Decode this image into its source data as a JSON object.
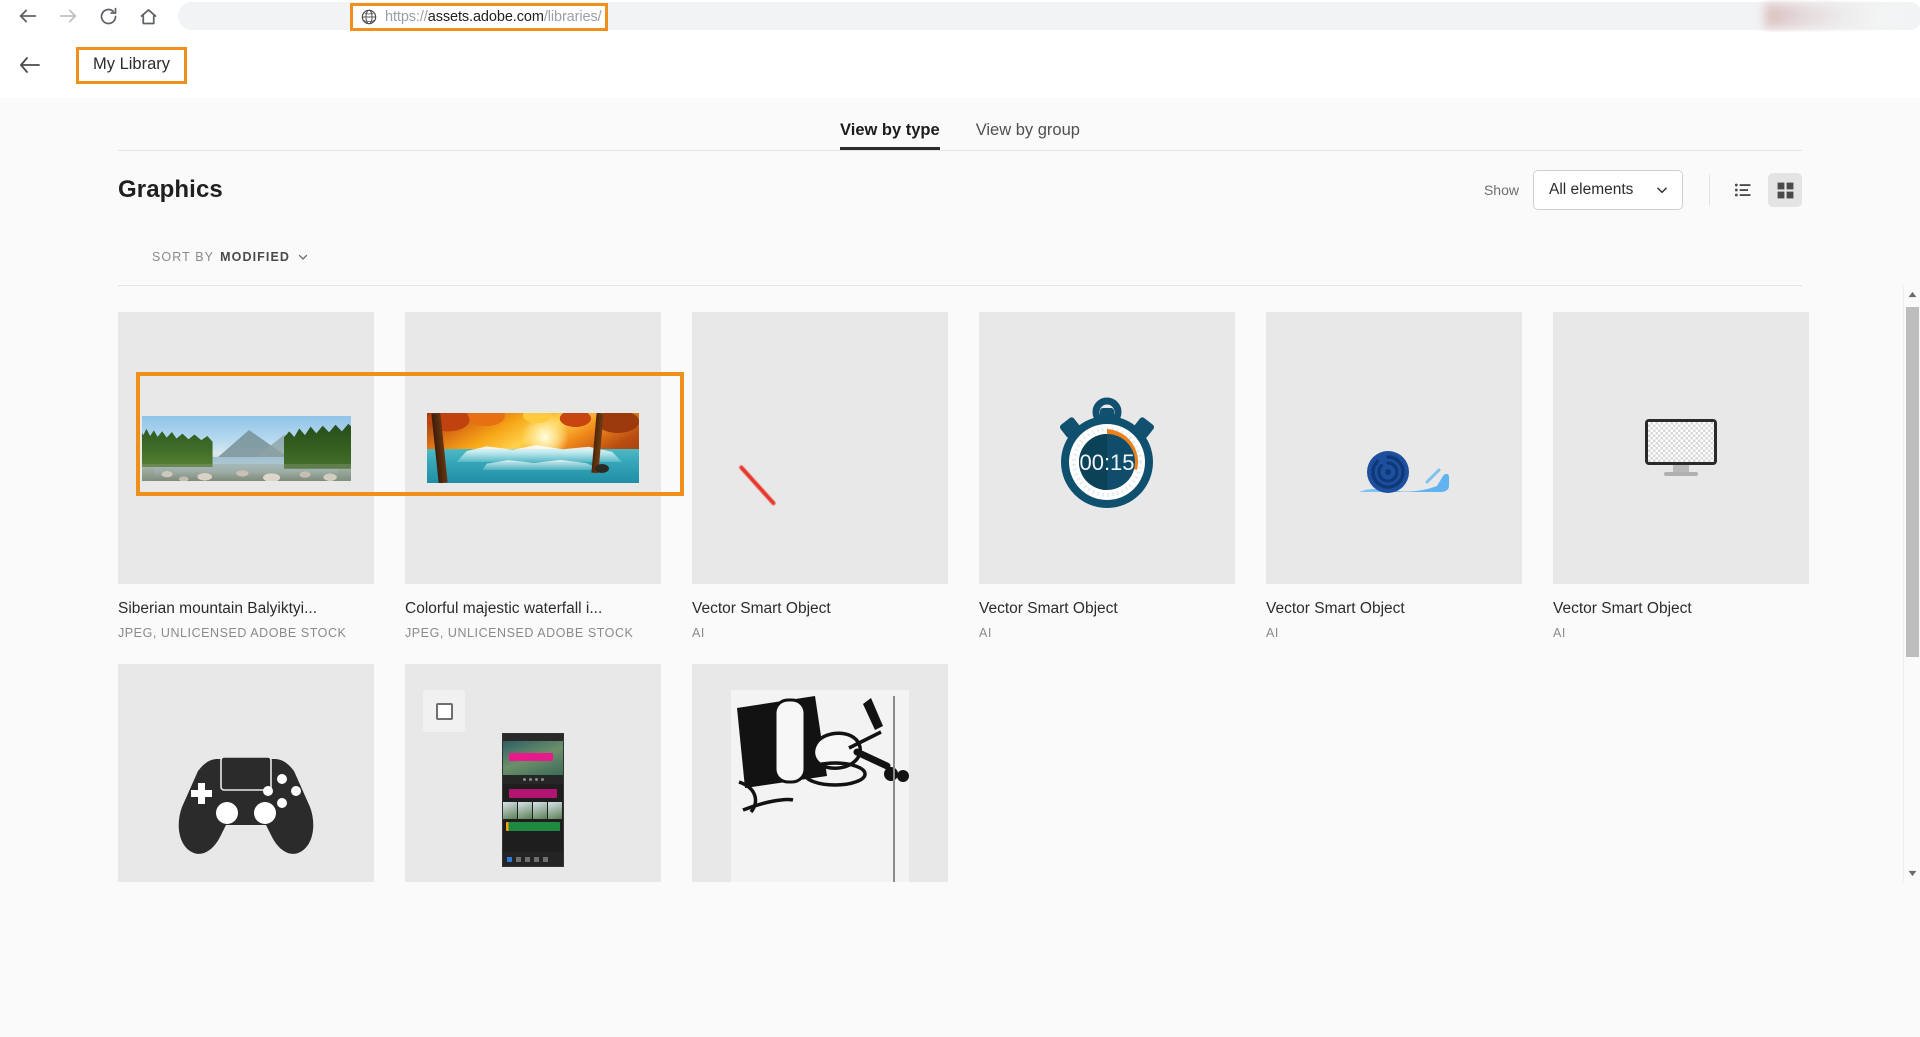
{
  "browser": {
    "back_icon": "arrow-left-icon",
    "forward_icon": "arrow-right-icon",
    "reload_icon": "reload-icon",
    "home_icon": "home-icon",
    "site_icon": "globe-icon",
    "url_prefix": "https://",
    "url_domain": "assets.adobe.com",
    "url_path": "/libraries/",
    "url_full": "https://assets.adobe.com/libraries/",
    "highlight_color": "#ef8f1c"
  },
  "app_header": {
    "back_icon": "arrow-left-icon",
    "breadcrumb": "My Library"
  },
  "tabs": [
    {
      "label": "View by type",
      "active": true
    },
    {
      "label": "View by group",
      "active": false
    }
  ],
  "section": {
    "title": "Graphics",
    "show_label": "Show",
    "filter_value": "All elements",
    "filter_chevron_icon": "chevron-down-icon",
    "list_view_icon": "list-view-icon",
    "grid_view_icon": "grid-view-icon",
    "active_view": "grid"
  },
  "sort": {
    "prefix": "SORT BY",
    "value": "MODIFIED",
    "chevron_icon": "chevron-down-icon"
  },
  "grid": {
    "items": [
      {
        "title": "Siberian mountain Balyiktyi...",
        "meta": "JPEG, UNLICENSED ADOBE STOCK",
        "thumb": "mountain-photo",
        "selected": true
      },
      {
        "title": "Colorful majestic waterfall i...",
        "meta": "JPEG, UNLICENSED ADOBE STOCK",
        "thumb": "waterfall-photo",
        "selected": true
      },
      {
        "title": "Vector Smart Object",
        "meta": "AI",
        "thumb": "red-line",
        "selected": false
      },
      {
        "title": "Vector Smart Object",
        "meta": "AI",
        "thumb": "stopwatch",
        "selected": false
      },
      {
        "title": "Vector Smart Object",
        "meta": "AI",
        "thumb": "snail",
        "selected": false
      },
      {
        "title": "Vector Smart Object",
        "meta": "AI",
        "thumb": "monitor",
        "selected": false
      },
      {
        "title": "",
        "meta": "",
        "thumb": "gamepad",
        "selected": false
      },
      {
        "title": "",
        "meta": "",
        "thumb": "video-editor-ui",
        "selected": false
      },
      {
        "title": "",
        "meta": "",
        "thumb": "bw-lineart",
        "selected": false
      }
    ],
    "stopwatch_time": "00:15"
  },
  "scrollbar": {
    "up_icon": "triangle-up-icon",
    "down_icon": "triangle-down-icon"
  }
}
